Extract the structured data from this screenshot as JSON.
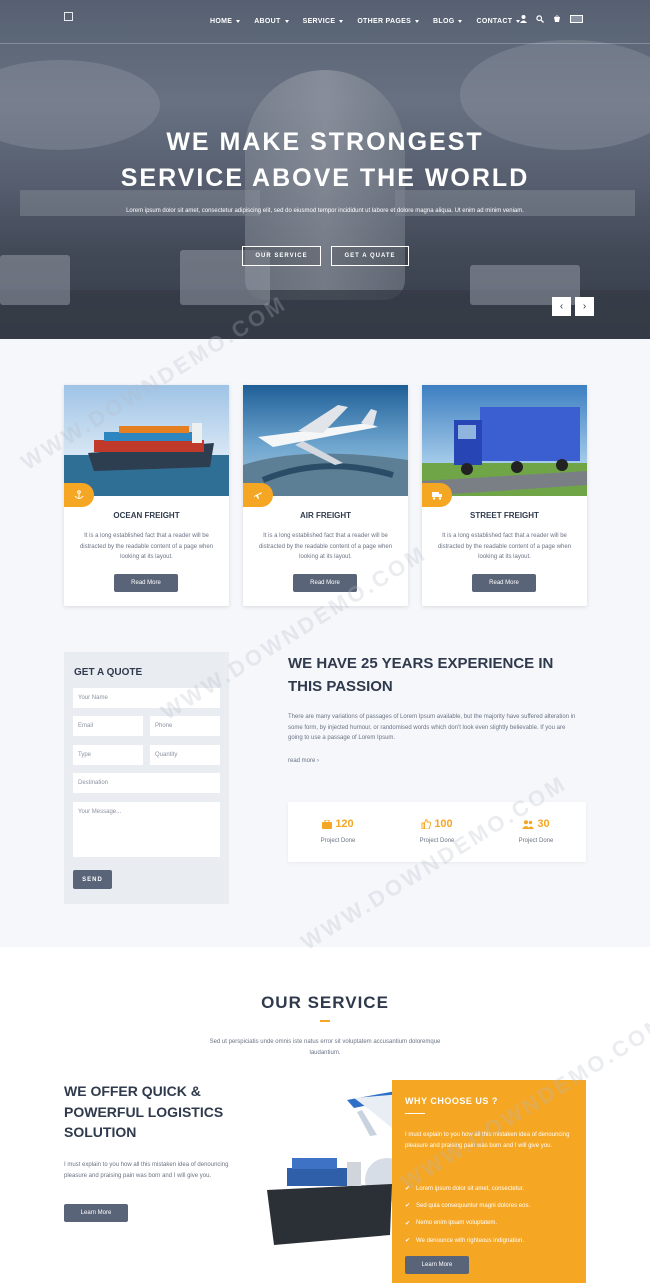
{
  "colors": {
    "accent": "#f5a623",
    "dark": "#2f3a4c",
    "button": "#5a6478",
    "section_bg": "#f5f7fb"
  },
  "nav": {
    "items": [
      "HOME",
      "ABOUT",
      "SERVICE",
      "OTHER PAGES",
      "BLOG",
      "CONTACT"
    ],
    "icons": [
      "user-icon",
      "search-icon",
      "cart-icon",
      "flag-icon"
    ]
  },
  "hero": {
    "title_line1": "WE MAKE STRONGEST",
    "title_line2": "SERVICE ABOVE THE WORLD",
    "subtitle": "Lorem ipsum dolor sit amet, consectetur adipiscing elit, sed do eiusmod tempor incididunt ut labore et dolore magna aliqua. Ut enim ad minim veniam.",
    "btn_service": "OUR SERVICE",
    "btn_quote": "GET A QUATE",
    "prev": "‹",
    "next": "›"
  },
  "cards": [
    {
      "title": "OCEAN FREIGHT",
      "text": "It is a long established fact that a reader will be distracted by the readable content of a page when looking at its layout.",
      "btn": "Read More",
      "icon": "anchor-icon"
    },
    {
      "title": "AIR FREIGHT",
      "text": "It is a long established fact that a reader will be distracted by the readable content of a page when looking at its layout.",
      "btn": "Read More",
      "icon": "plane-icon"
    },
    {
      "title": "STREET FREIGHT",
      "text": "It is a long established fact that a reader will be distracted by the readable content of a page when looking at its layout.",
      "btn": "Read More",
      "icon": "truck-icon"
    }
  ],
  "quote": {
    "title": "GET A QUOTE",
    "name_ph": "Your Name",
    "email_ph": "Email",
    "phone_ph": "Phone",
    "type_ph": "Type",
    "quantity_ph": "Quantity",
    "destination_ph": "Destination",
    "message_ph": "Your Message...",
    "send": "SEND"
  },
  "experience": {
    "title": "WE HAVE 25 YEARS EXPERIENCE IN THIS PASSION",
    "text": "There are many variations of passages of Lorem Ipsum available, but the majority have suffered alteration in some form, by injected humour, or randomised words which don't look even slightly believable. If you are going to use a passage of Lorem Ipsum.",
    "more": "read more ›",
    "stats": [
      {
        "value": "120",
        "label": "Project Done",
        "icon": "briefcase-icon"
      },
      {
        "value": "100",
        "label": "Project Done",
        "icon": "thumbs-up-icon"
      },
      {
        "value": "30",
        "label": "Project Done",
        "icon": "users-icon"
      }
    ]
  },
  "service": {
    "title": "OUR SERVICE",
    "subtitle": "Sed ut perspiciatis unde omnis iste natus error sit voluptatem accusantium doloremque laudantium.",
    "offer_title": "WE OFFER QUICK & POWERFUL LOGISTICS SOLUTION",
    "offer_text": "I must explain to you how all this mistaken idea of denouncing pleasure and praising pain was born and I will give you.",
    "offer_btn": "Learn More"
  },
  "why": {
    "title": "WHY CHOOSE US ?",
    "text": "I must explain to you how all this mistaken idea of denouncing pleasure and praising pain was born and I will give you.",
    "items": [
      "Lorem ipsum dolor sit amet, consectetur.",
      "Sed quia consequuntur magni dolores eos.",
      "Nemo enim ipsam voluptatem.",
      "We denounce with righteous indignation."
    ],
    "btn": "Learn More"
  },
  "watermark": "WWW.DOWNDEMO.COM"
}
